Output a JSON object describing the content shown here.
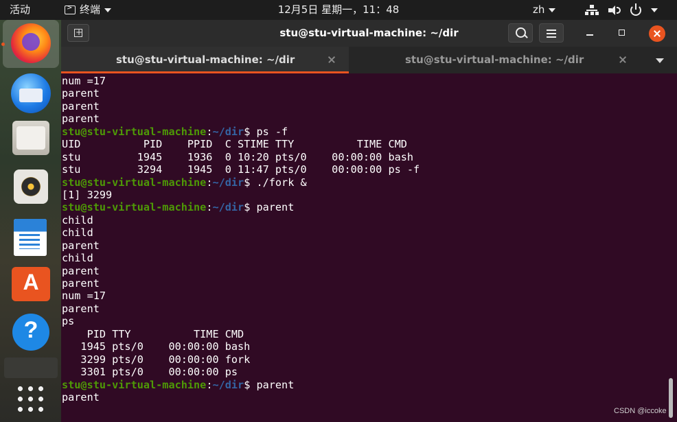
{
  "topbar": {
    "activities": "活动",
    "app_name": "终端",
    "clock": "12月5日 星期一，11：48",
    "input_method": "zh"
  },
  "window": {
    "title": "stu@stu-virtual-machine: ~/dir"
  },
  "tabs": [
    {
      "label": "stu@stu-virtual-machine: ~/dir",
      "active": true
    },
    {
      "label": "stu@stu-virtual-machine: ~/dir",
      "active": false
    }
  ],
  "terminal": {
    "lines": [
      {
        "text": "num =17"
      },
      {
        "text": "parent"
      },
      {
        "text": "parent"
      },
      {
        "text": "parent"
      },
      {
        "user": "stu@stu-virtual-machine",
        "sep": ":",
        "path": "~/dir",
        "cmd": "$ ps -f"
      },
      {
        "text": "UID          PID    PPID  C STIME TTY          TIME CMD"
      },
      {
        "text": "stu         1945    1936  0 10:20 pts/0    00:00:00 bash"
      },
      {
        "text": "stu         3294    1945  0 11:47 pts/0    00:00:00 ps -f"
      },
      {
        "user": "stu@stu-virtual-machine",
        "sep": ":",
        "path": "~/dir",
        "cmd": "$ ./fork &"
      },
      {
        "text": "[1] 3299"
      },
      {
        "user": "stu@stu-virtual-machine",
        "sep": ":",
        "path": "~/dir",
        "cmd": "$ parent"
      },
      {
        "text": "child"
      },
      {
        "text": "child"
      },
      {
        "text": "parent"
      },
      {
        "text": "child"
      },
      {
        "text": "parent"
      },
      {
        "text": "parent"
      },
      {
        "text": "num =17"
      },
      {
        "text": "parent"
      },
      {
        "text": "ps"
      },
      {
        "text": "    PID TTY          TIME CMD"
      },
      {
        "text": "   1945 pts/0    00:00:00 bash"
      },
      {
        "text": "   3299 pts/0    00:00:00 fork"
      },
      {
        "text": "   3301 pts/0    00:00:00 ps"
      },
      {
        "user": "stu@stu-virtual-machine",
        "sep": ":",
        "path": "~/dir",
        "cmd": "$ parent"
      },
      {
        "text": "parent"
      }
    ]
  },
  "watermark": "CSDN @iccoke",
  "colors": {
    "terminal_bg": "#300a24",
    "prompt_user": "#4e9a06",
    "prompt_path": "#3465a4",
    "accent": "#e95420"
  }
}
